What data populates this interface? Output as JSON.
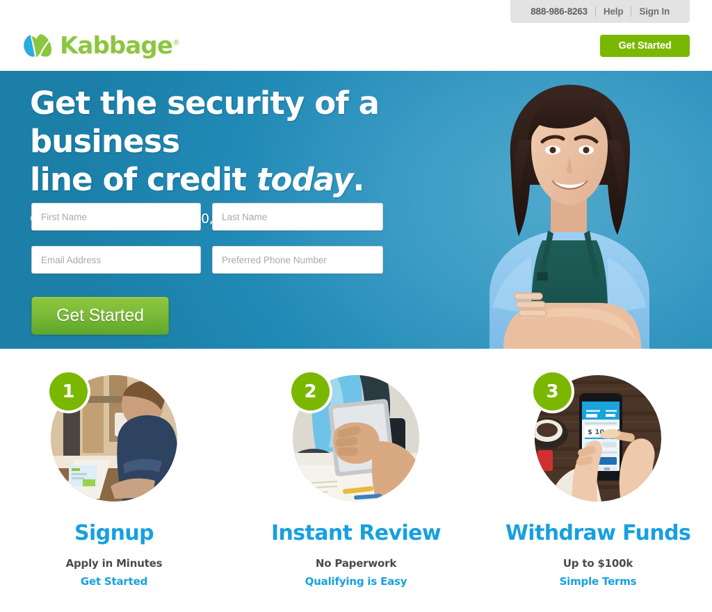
{
  "utility": {
    "phone": "888-986-8263",
    "help_label": "Help",
    "signin_label": "Sign In"
  },
  "header": {
    "brand_name": "Kabbage",
    "trademark": "®",
    "cta_label": "Get Started",
    "brand_green": "#7ab800",
    "logo_blue": "#29abe2"
  },
  "hero": {
    "headline_line1": "Get the security of a business",
    "headline_line2_plain": "line of credit ",
    "headline_line2_italic": "today",
    "headline_line2_end": ".",
    "subheadline": "Qualify for a line up to $100,000 in minutes!",
    "cta_label": "Get Started",
    "background_blue": "#2089b5",
    "form": {
      "first_name": {
        "value": "",
        "placeholder": "First Name"
      },
      "last_name": {
        "value": "",
        "placeholder": "Last Name"
      },
      "email": {
        "value": "",
        "placeholder": "Email Address"
      },
      "phone": {
        "value": "",
        "placeholder": "Preferred Phone Number"
      }
    },
    "photo_alt": "smiling-female-small-business-owner-in-apron"
  },
  "steps": [
    {
      "number": "1",
      "title": "Signup",
      "description": "Apply in Minutes",
      "link_label": "Get Started",
      "image_alt": "man-working-on-laptop-in-workshop"
    },
    {
      "number": "2",
      "title": "Instant Review",
      "description": "No Paperwork",
      "link_label": "Qualifying is Easy",
      "image_alt": "person-holding-tablet-at-desk"
    },
    {
      "number": "3",
      "title": "Withdraw Funds",
      "description": "Up to $100k",
      "link_label": "Simple Terms",
      "image_alt": "hand-holding-phone-showing-10000-withdrawal"
    }
  ],
  "colors": {
    "accent_blue": "#17a0e0",
    "accent_green": "#7ab800",
    "hero_blue": "#2089b5",
    "utility_gray": "#e3e3e3"
  }
}
